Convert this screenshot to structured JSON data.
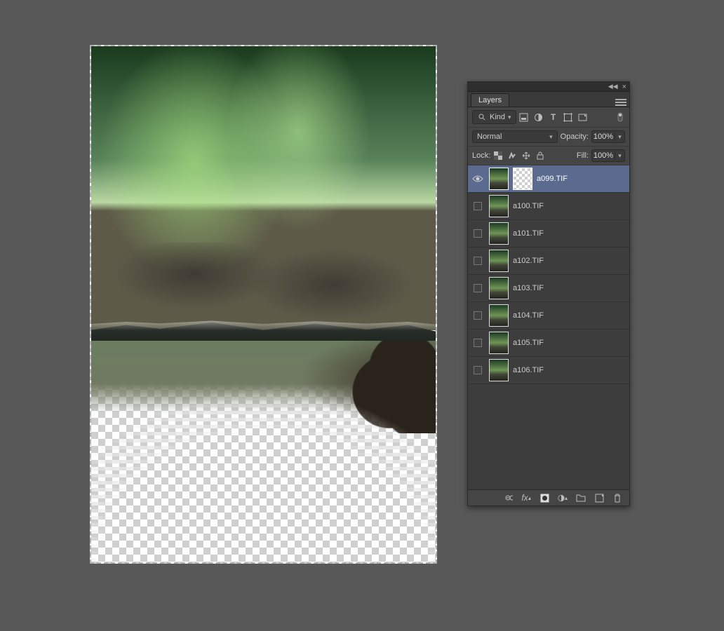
{
  "panel": {
    "title": "Layers",
    "filter": {
      "mode": "Kind"
    },
    "blend_mode": "Normal",
    "opacity_label": "Opacity:",
    "opacity_value": "100%",
    "lock_label": "Lock:",
    "fill_label": "Fill:",
    "fill_value": "100%"
  },
  "layers": [
    {
      "name": "a099.TIF",
      "visible": true,
      "selected": true,
      "has_mask": true
    },
    {
      "name": "a100.TIF",
      "visible": false,
      "selected": false,
      "has_mask": false
    },
    {
      "name": "a101.TIF",
      "visible": false,
      "selected": false,
      "has_mask": false
    },
    {
      "name": "a102.TIF",
      "visible": false,
      "selected": false,
      "has_mask": false
    },
    {
      "name": "a103.TIF",
      "visible": false,
      "selected": false,
      "has_mask": false
    },
    {
      "name": "a104.TIF",
      "visible": false,
      "selected": false,
      "has_mask": false
    },
    {
      "name": "a105.TIF",
      "visible": false,
      "selected": false,
      "has_mask": false
    },
    {
      "name": "a106.TIF",
      "visible": false,
      "selected": false,
      "has_mask": false
    }
  ]
}
